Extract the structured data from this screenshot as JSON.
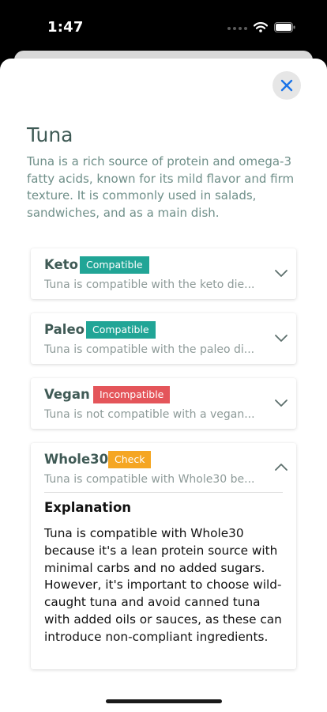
{
  "status_bar": {
    "time": "1:47"
  },
  "food": {
    "title": "Tuna",
    "description": "Tuna is a rich source of protein and omega-3 fatty acids, known for its mild flavor and firm texture. It is commonly used in salads, sandwiches, and as a main dish."
  },
  "diets": [
    {
      "name": "Keto",
      "status": "Compatible",
      "summary": "Tuna is compatible with the keto die...",
      "expanded": false
    },
    {
      "name": "Paleo",
      "status": "Compatible",
      "summary": "Tuna is compatible with the paleo di...",
      "expanded": false
    },
    {
      "name": "Vegan",
      "status": "Incompatible",
      "summary": "Tuna is not compatible with a vegan...",
      "expanded": false
    },
    {
      "name": "Whole30",
      "status": "Check",
      "summary": "Tuna is compatible with Whole30 be...",
      "expanded": true
    }
  ],
  "explanation": {
    "heading": "Explanation",
    "body": "Tuna is compatible with Whole30 because it's a lean protein source with minimal carbs and no added sugars. However, it's important to choose wild-caught tuna and avoid canned tuna with added oils or sauces, as these can introduce non-compliant ingredients."
  },
  "colors": {
    "compatible": "#21a596",
    "incompatible": "#e4555a",
    "check": "#f5a623",
    "close_icon": "#1a73e8",
    "title_text": "#3f5a55"
  },
  "icons": [
    "cellular-dots-icon",
    "wifi-icon",
    "battery-icon",
    "close-icon",
    "chevron-down-icon",
    "chevron-up-icon"
  ]
}
